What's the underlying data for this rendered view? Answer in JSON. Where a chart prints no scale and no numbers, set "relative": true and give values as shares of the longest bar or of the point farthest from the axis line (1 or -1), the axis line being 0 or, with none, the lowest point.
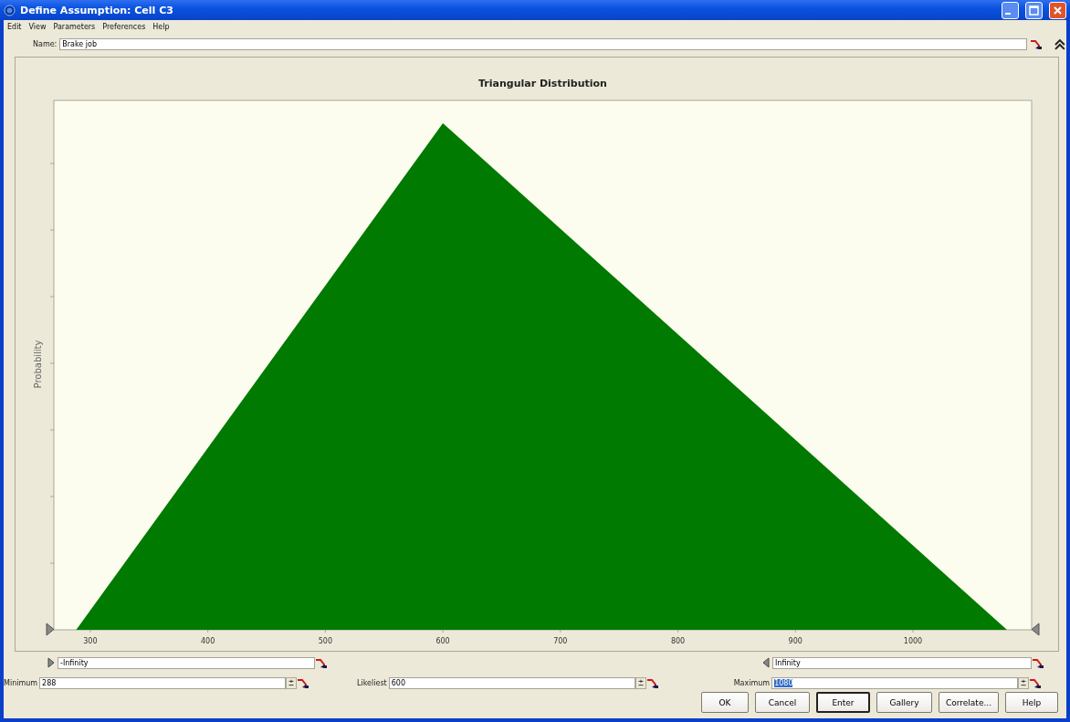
{
  "window": {
    "title": "Define Assumption: Cell C3"
  },
  "menu": [
    "Edit",
    "View",
    "Parameters",
    "Preferences",
    "Help"
  ],
  "name_field": {
    "label": "Name:",
    "value": "Brake job"
  },
  "chart": {
    "chart_data": {
      "type": "area",
      "title": "Triangular Distribution",
      "ylabel": "Probability",
      "x": [
        288,
        600,
        1080
      ],
      "series": [
        {
          "color": "#007a00",
          "values": [
            0,
            1,
            0
          ]
        }
      ],
      "relative": true,
      "xlim": [
        269,
        1101
      ],
      "xticks": [
        300,
        400,
        500,
        600,
        700,
        800,
        900,
        1000
      ]
    }
  },
  "bounds": [
    {
      "kind": "lower",
      "value": "-Infinity"
    },
    {
      "kind": "upper",
      "value": "Infinity"
    }
  ],
  "parameters": [
    {
      "label": "Minimum",
      "value": "288",
      "text_selected": false
    },
    {
      "label": "Likeliest",
      "value": "600",
      "text_selected": false
    },
    {
      "label": "Maximum",
      "value": "1080",
      "text_selected": true
    }
  ],
  "buttons": [
    {
      "label": "OK",
      "default": false
    },
    {
      "label": "Cancel",
      "default": false
    },
    {
      "label": "Enter",
      "default": true
    },
    {
      "label": "Gallery",
      "default": false
    },
    {
      "label": "Correlate...",
      "default": false
    },
    {
      "label": "Help",
      "default": false
    }
  ]
}
